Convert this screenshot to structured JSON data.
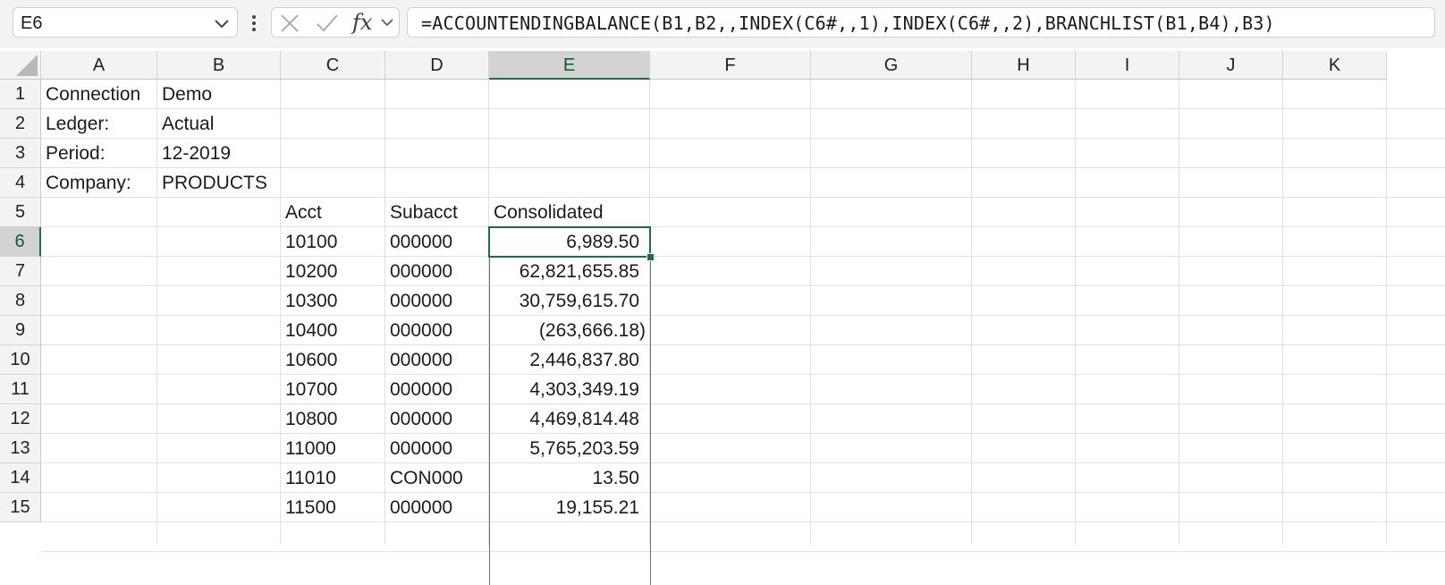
{
  "formula_bar": {
    "name_box": "E6",
    "fx_label": "fx",
    "formula": "=ACCOUNTENDINGBALANCE(B1,B2,,INDEX(C6#,,1),INDEX(C6#,,2),BRANCHLIST(B1,B4),B3)"
  },
  "columns": [
    "A",
    "B",
    "C",
    "D",
    "E",
    "F",
    "G",
    "H",
    "I",
    "J",
    "K"
  ],
  "rows": [
    "1",
    "2",
    "3",
    "4",
    "5",
    "6",
    "7",
    "8",
    "9",
    "10",
    "11",
    "12",
    "13",
    "14",
    "15"
  ],
  "active_cell": "E6",
  "cells": {
    "A1": "Connection",
    "B1": "Demo",
    "A2": "Ledger:",
    "B2": "Actual",
    "A3": "Period:",
    "B3": "12-2019",
    "A4": "Company:",
    "B4": "PRODUCTS",
    "C5": "Acct",
    "D5": "Subacct",
    "E5": "Consolidated"
  },
  "table_rows": [
    {
      "acct": "10100",
      "subacct": "000000",
      "consolidated": "6,989.50"
    },
    {
      "acct": "10200",
      "subacct": "000000",
      "consolidated": "62,821,655.85"
    },
    {
      "acct": "10300",
      "subacct": "000000",
      "consolidated": "30,759,615.70"
    },
    {
      "acct": "10400",
      "subacct": "000000",
      "consolidated": "(263,666.18)"
    },
    {
      "acct": "10600",
      "subacct": "000000",
      "consolidated": "2,446,837.80"
    },
    {
      "acct": "10700",
      "subacct": "000000",
      "consolidated": "4,303,349.19"
    },
    {
      "acct": "10800",
      "subacct": "000000",
      "consolidated": "4,469,814.48"
    },
    {
      "acct": "11000",
      "subacct": "000000",
      "consolidated": "5,765,203.59"
    },
    {
      "acct": "11010",
      "subacct": "CON000",
      "consolidated": "13.50"
    },
    {
      "acct": "11500",
      "subacct": "000000",
      "consolidated": "19,155.21"
    }
  ],
  "colors": {
    "selection_green": "#1e6e3e",
    "spill_blue": "#4472c4",
    "header_gray": "#f3f3f3"
  }
}
